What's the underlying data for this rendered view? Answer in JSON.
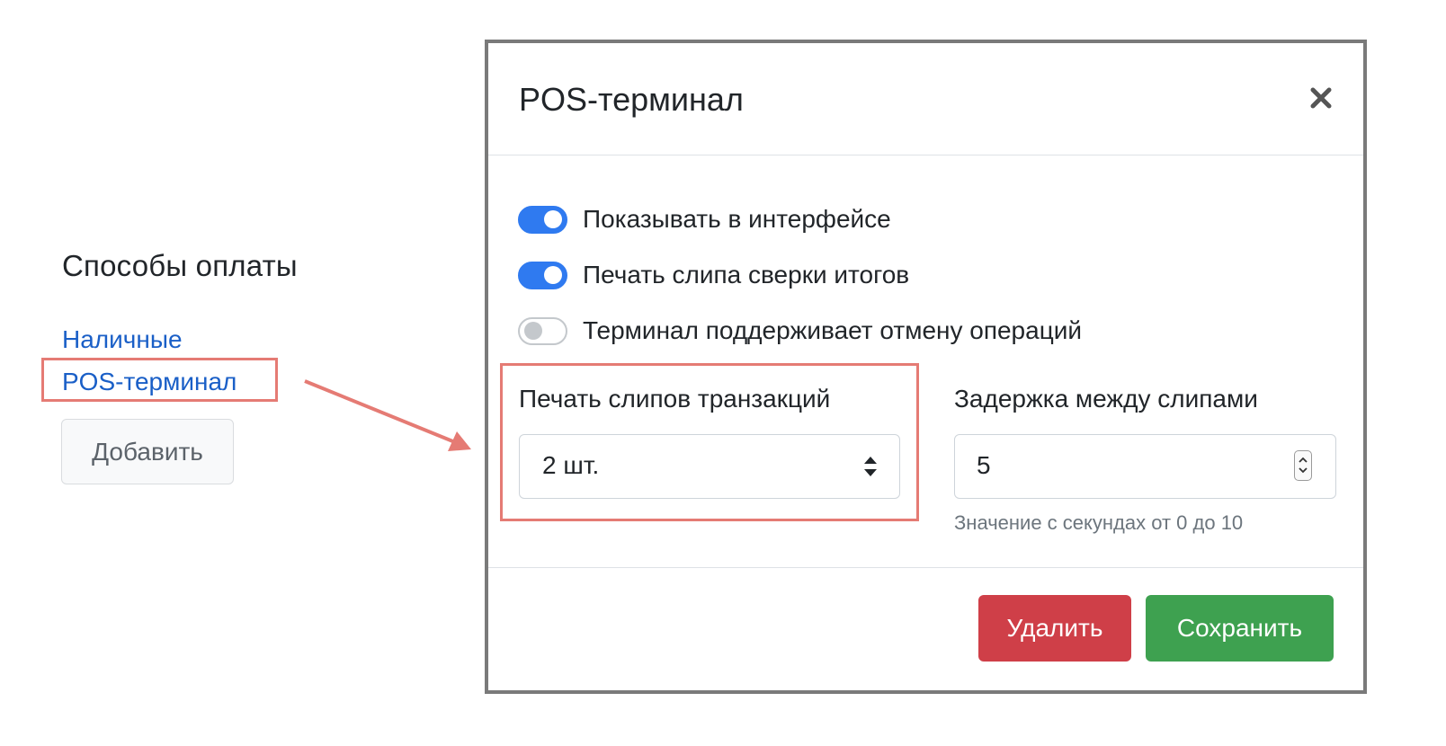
{
  "page": {
    "section_title": "Способы оплаты",
    "links": [
      "Наличные",
      "POS-терминал"
    ],
    "add_button": "Добавить"
  },
  "modal": {
    "title": "POS-терминал",
    "close_icon": "close-icon",
    "toggles": [
      {
        "label": "Показывать в интерфейсе",
        "on": true
      },
      {
        "label": "Печать слипа сверки итогов",
        "on": true
      },
      {
        "label": "Терминал поддерживает отмену операций",
        "on": false
      }
    ],
    "slip_print": {
      "label": "Печать слипов транзакций",
      "value": "2 шт."
    },
    "slip_delay": {
      "label": "Задержка между слипами",
      "value": "5",
      "hint": "Значение с секундах от 0 до 10"
    },
    "buttons": {
      "delete": "Удалить",
      "save": "Сохранить"
    }
  },
  "colors": {
    "accent": "#2f7af0",
    "link": "#1a5fc7",
    "danger": "#cf3f48",
    "success": "#3ea150",
    "annotation": "#e57b74"
  }
}
